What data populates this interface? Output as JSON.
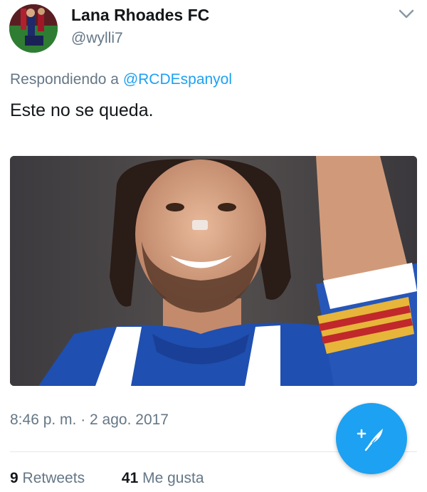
{
  "tweet": {
    "author": {
      "display_name": "Lana Rhoades FC",
      "handle": "@wylli7",
      "avatar_icon": "avatar-photo"
    },
    "reply": {
      "prefix": "Respondiendo a",
      "mention": "@RCDEspanyol"
    },
    "text": "Este no se queda.",
    "media": {
      "kind": "photo",
      "description_icon": "player-photo"
    },
    "timestamp": "8:46 p. m. · 2 ago. 2017",
    "stats": {
      "retweets_count": "9",
      "retweets_label": "Retweets",
      "likes_count": "41",
      "likes_label": "Me gusta"
    }
  },
  "ui": {
    "menu_icon": "chevron-down-icon",
    "compose_icon": "compose-quill-icon",
    "colors": {
      "accent": "#1da1f2",
      "text_primary": "#14171a",
      "text_secondary": "#657786",
      "divider": "#e1e8ed"
    }
  }
}
